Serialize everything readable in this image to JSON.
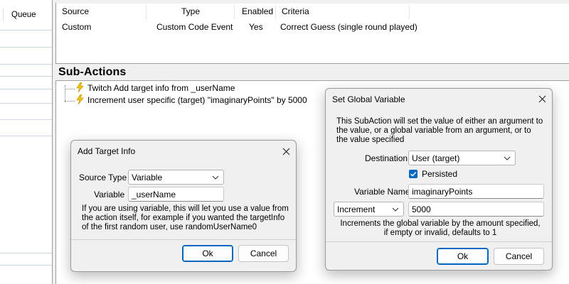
{
  "left_panel": {
    "header": "Queue"
  },
  "triggers": {
    "columns": {
      "source": "Source",
      "type": "Type",
      "enabled": "Enabled",
      "criteria": "Criteria"
    },
    "rows": [
      {
        "source": "Custom",
        "type": "Custom Code Event",
        "enabled": "Yes",
        "criteria": "Correct Guess (single round played)"
      }
    ]
  },
  "subactions": {
    "title": "Sub-Actions",
    "items": [
      {
        "label": "Twitch Add target info from _userName",
        "icon": "lightning-bolt-icon"
      },
      {
        "label": "Increment user specific (target) \"imaginaryPoints\" by 5000",
        "icon": "lightning-bolt-icon"
      }
    ]
  },
  "add_target_dialog": {
    "title": "Add Target Info",
    "source_type_label": "Source Type",
    "source_type_value": "Variable",
    "variable_label": "Variable",
    "variable_value": "_userName",
    "help_text": "If you are using variable, this will let you use a value from the action itself, for example if you wanted the targetInfo of the first random user, use randomUserName0",
    "ok_label": "Ok",
    "cancel_label": "Cancel"
  },
  "global_var_dialog": {
    "title": "Set Global Variable",
    "description": "This SubAction will set the value of either an argument to the value, or a global variable from an argument, or to the value specified",
    "destination_label": "Destination",
    "destination_value": "User (target)",
    "persisted_label": "Persisted",
    "persisted_checked": true,
    "variable_name_label": "Variable Name",
    "variable_name_value": "imaginaryPoints",
    "operation_value": "Increment",
    "amount_value": "5000",
    "help_text": "Increments the global variable by the amount specified, if empty or invalid, defaults to 1",
    "ok_label": "Ok",
    "cancel_label": "Cancel"
  },
  "colors": {
    "accent": "#0067c0",
    "bolt": "#e6b800"
  }
}
